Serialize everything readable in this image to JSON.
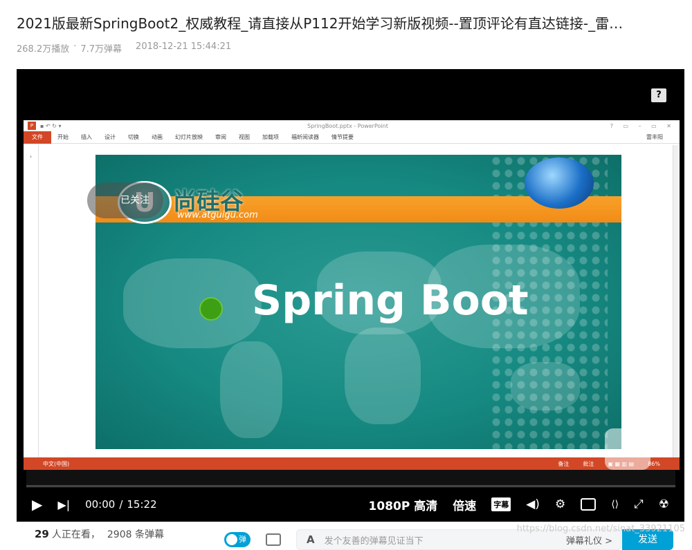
{
  "video": {
    "title": "2021版最新SpringBoot2_权威教程_请直接从P112开始学习新版视频--置顶评论有直达链接-_雷…",
    "plays": "268.2万播放",
    "separator": "·",
    "danmaku_count": "7.7万弹幕",
    "upload_time": "2018-12-21 15:44:21"
  },
  "ppt": {
    "logo": "P",
    "filename": "SpringBoot.pptx - PowerPoint",
    "file_tab": "文件",
    "tabs": [
      "开始",
      "插入",
      "设计",
      "切换",
      "动画",
      "幻灯片放映",
      "审阅",
      "视图",
      "加载项",
      "福昕阅读器",
      "情节提要"
    ],
    "user": "雷丰阳",
    "status_lang": "中文(中国)",
    "status_notes": "备注",
    "status_comments": "批注",
    "zoom": "86%"
  },
  "slide": {
    "logo_letter": "U",
    "logo_text": "尚硅谷",
    "logo_url": "www.atguigu.com",
    "headline": "Spring Boot"
  },
  "overlay": {
    "follow_badge": "已关注"
  },
  "controls": {
    "current_time": "00:00",
    "time_sep": "/",
    "duration": "15:22",
    "quality": "1080P 高清",
    "speed": "倍速",
    "subtitle": "字幕",
    "progress": 0.0
  },
  "bottom": {
    "viewers_count": "29",
    "viewers_label": "人正在看，",
    "danmaku_loaded": "2908 条弹幕",
    "danmu_toggle": "弹",
    "danmu_placeholder": "发个友善的弹幕见证当下",
    "etiquette": "弹幕礼仪 >",
    "send": "发送",
    "watermark": "https://blog.csdn.net/sinat_33921105"
  },
  "colors": {
    "accent": "#00a1d6",
    "ppt_orange": "#d24726",
    "slide_teal": "#168a82"
  }
}
